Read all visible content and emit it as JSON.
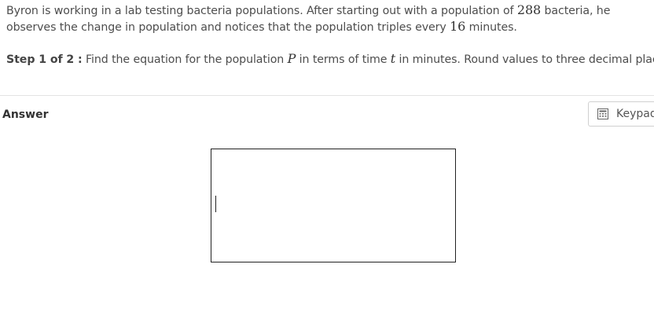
{
  "problem": {
    "text_1": "Byron is working in a lab testing bacteria populations.  After starting out with a population of ",
    "initial_population": "288",
    "text_2": " bacteria, he observes the change in population and notices that the population triples every ",
    "interval": "16",
    "text_3": " minutes."
  },
  "step": {
    "label": "Step 1 of 2 :",
    "text_1": " Find the equation for the population ",
    "var_p": "P",
    "text_2": " in terms of time ",
    "var_t": "t",
    "text_3": " in minutes. Round values to three decimal places."
  },
  "answer": {
    "label": "Answer",
    "value": ""
  },
  "keypad": {
    "label": "Keypad",
    "icon": "calculator-icon"
  }
}
